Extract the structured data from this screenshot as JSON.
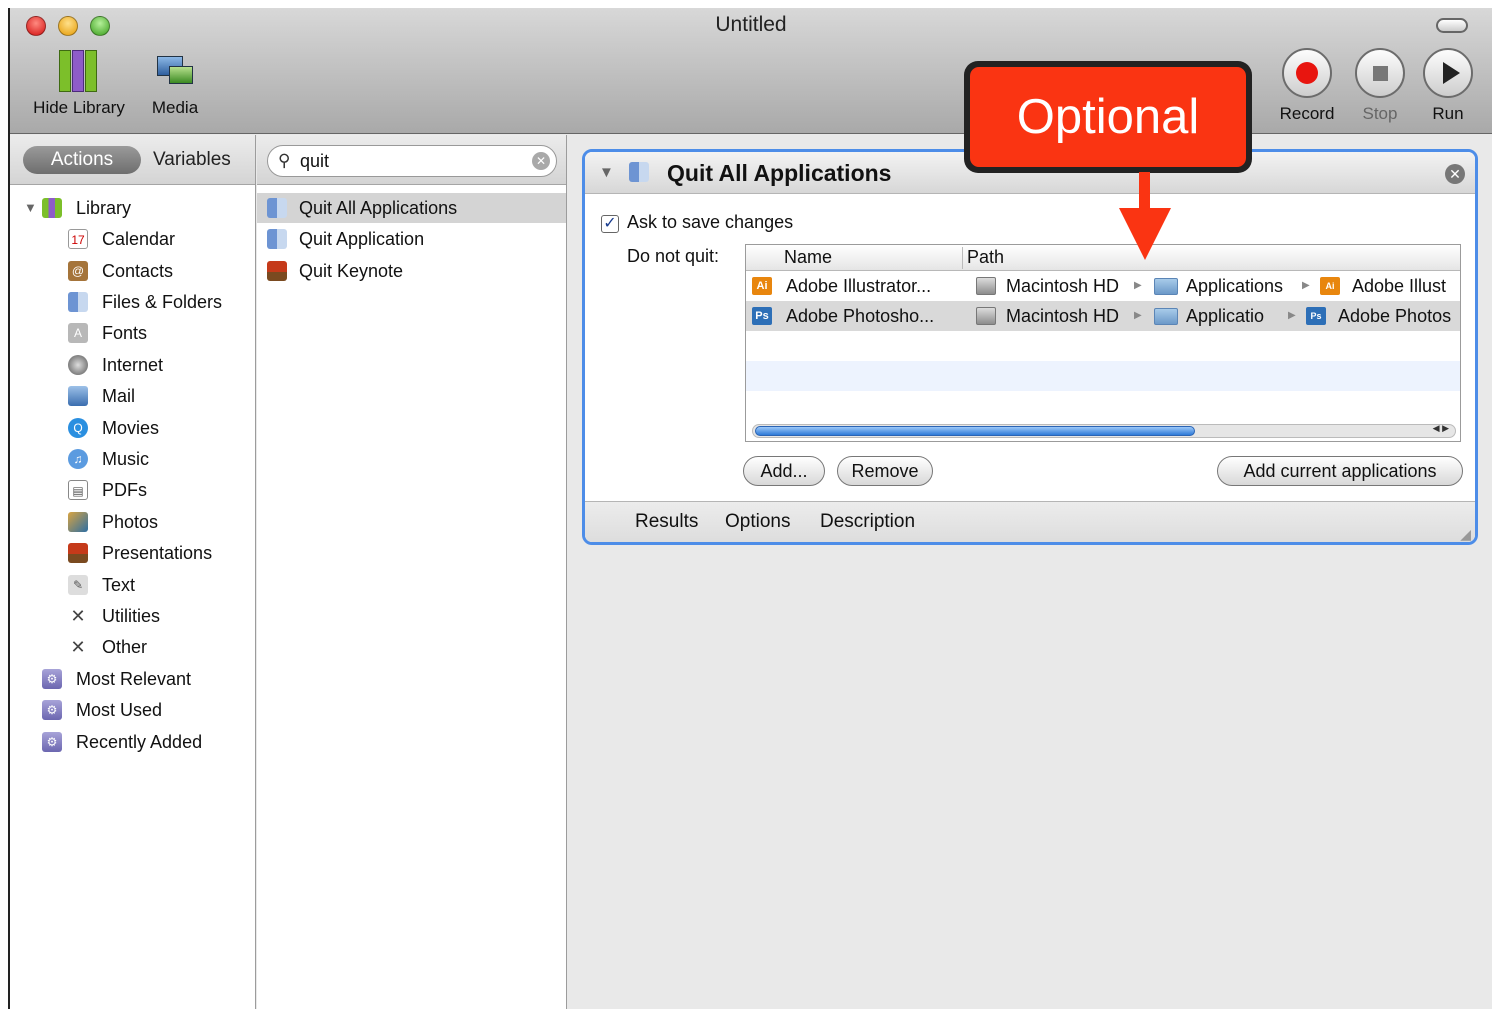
{
  "window": {
    "title": "Untitled"
  },
  "toolbar": {
    "hide_library": "Hide Library",
    "media": "Media",
    "record": "Record",
    "stop": "Stop",
    "run": "Run"
  },
  "library_pane": {
    "tab_actions": "Actions",
    "tab_variables": "Variables",
    "root": "Library",
    "items": [
      "Calendar",
      "Contacts",
      "Files & Folders",
      "Fonts",
      "Internet",
      "Mail",
      "Movies",
      "Music",
      "PDFs",
      "Photos",
      "Presentations",
      "Text",
      "Utilities",
      "Other"
    ],
    "smart_groups": [
      "Most Relevant",
      "Most Used",
      "Recently Added"
    ]
  },
  "search": {
    "value": "quit"
  },
  "results": [
    "Quit All Applications",
    "Quit Application",
    "Quit Keynote"
  ],
  "action": {
    "title": "Quit All Applications",
    "ask_to_save_label": "Ask to save changes",
    "ask_to_save_checked": true,
    "do_not_quit_label": "Do not quit:",
    "columns": [
      "Name",
      "Path"
    ],
    "rows": [
      {
        "name": "Adobe Illustrator...",
        "icon": "illustrator-icon",
        "path": [
          "Macintosh HD",
          "Applications",
          "Adobe Illust"
        ]
      },
      {
        "name": "Adobe Photosho...",
        "icon": "photoshop-icon",
        "path": [
          "Macintosh HD",
          "Applicatio",
          "Adobe Photos"
        ]
      }
    ],
    "add_button": "Add...",
    "remove_button": "Remove",
    "add_current_button": "Add current applications",
    "footer_tabs": [
      "Results",
      "Options",
      "Description"
    ]
  },
  "callout": {
    "text": "Optional"
  },
  "colors": {
    "accent_border": "#4d8de8",
    "callout": "#fa3412",
    "record": "#e8150f"
  }
}
